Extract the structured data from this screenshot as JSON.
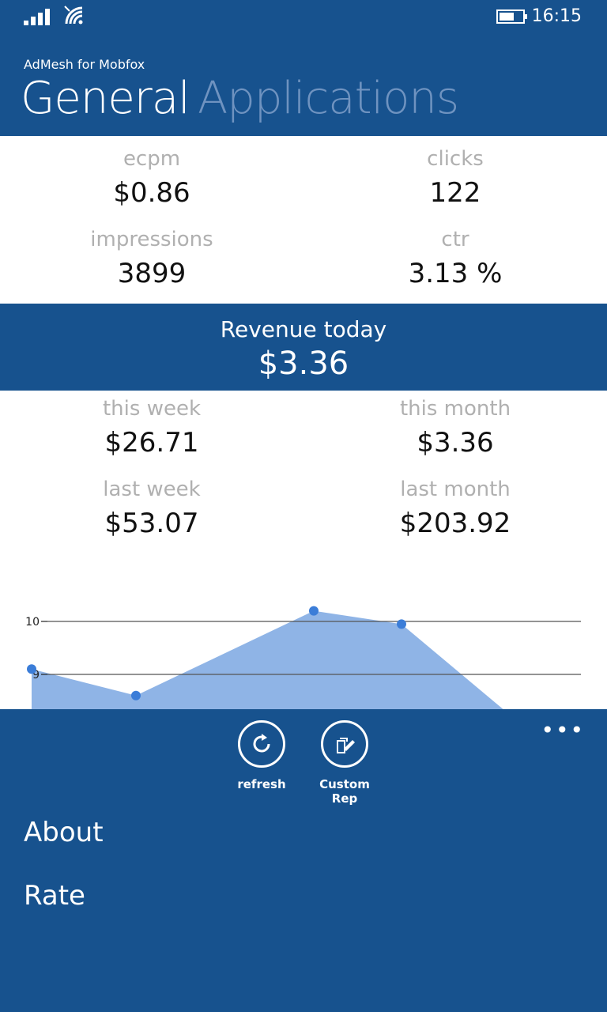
{
  "status": {
    "time": "16:15"
  },
  "header": {
    "app_title": "AdMesh for Mobfox",
    "tab_general": "General",
    "tab_applications": "Applications"
  },
  "stats": {
    "ecpm_label": "ecpm",
    "ecpm_value": "$0.86",
    "clicks_label": "clicks",
    "clicks_value": "122",
    "impressions_label": "impressions",
    "impressions_value": "3899",
    "ctr_label": "ctr",
    "ctr_value": "3.13 %"
  },
  "revenue": {
    "label": "Revenue today",
    "value": "$3.36"
  },
  "periods": {
    "this_week_label": "this week",
    "this_week_value": "$26.71",
    "this_month_label": "this month",
    "this_month_value": "$3.36",
    "last_week_label": "last week",
    "last_week_value": "$53.07",
    "last_month_label": "last month",
    "last_month_value": "$203.92"
  },
  "chart_data": {
    "type": "area",
    "x": [
      1,
      2,
      3,
      4,
      5
    ],
    "y": [
      9.1,
      8.6,
      10.2,
      9.95,
      8.3
    ],
    "y_ticks": [
      "10",
      "9"
    ],
    "grid": true,
    "color": "#8fb4e6",
    "point_color": "#3b7dd8"
  },
  "appbar": {
    "refresh_label": "refresh",
    "custom_label": "Custom Rep",
    "more": "•••"
  },
  "menu": {
    "about": "About",
    "rate": "Rate"
  },
  "colors": {
    "primary": "#17528e",
    "accent": "#3b7dd8",
    "inactive_tab": "#6f93c0"
  }
}
